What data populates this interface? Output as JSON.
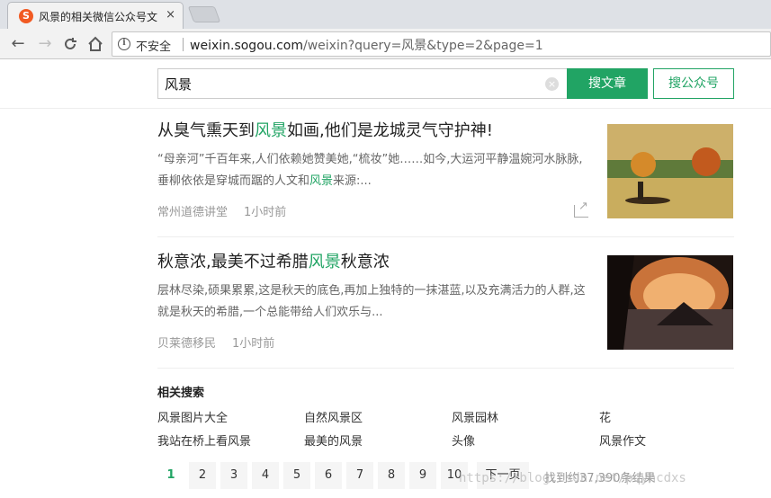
{
  "browser": {
    "tab_title": "风景的相关微信公众号文",
    "tab_close": "×",
    "back": "←",
    "forward": "→",
    "reload": "C",
    "home": "⌂",
    "security_info": "i",
    "insecure_label": "不安全",
    "url_host": "weixin.sogou.com",
    "url_path": "/weixin?query=风景&type=2&page=1"
  },
  "search": {
    "query": "风景",
    "clear": "×",
    "search_articles_label": "搜文章",
    "search_accounts_label": "搜公众号"
  },
  "results": [
    {
      "title_pre": "从臭气熏天到",
      "title_hl": "风景",
      "title_post": "如画,他们是龙城灵气守护神!",
      "desc_pre": "“母亲河”千百年来,人们依赖她赞美她,“梳妆”她……如今,大运河平静温婉河水脉脉,垂柳依依是穿城而踞的人文和",
      "desc_hl": "风景",
      "desc_post": "来源:...",
      "source": "常州道德讲堂",
      "time": "1小时前"
    },
    {
      "title_pre": "秋意浓,最美不过希腊",
      "title_hl": "风景",
      "title_post": "秋意浓",
      "desc_pre": "层林尽染,硕果累累,这是秋天的底色,再加上独特的一抹湛蓝,以及充满活力的人群,这就是秋天的希腊,一个总能带给人们欢乐与...",
      "desc_hl": "",
      "desc_post": "",
      "source": "贝莱德移民",
      "time": "1小时前"
    }
  ],
  "related": {
    "title": "相关搜索",
    "items": [
      "风景图片大全",
      "自然风景区",
      "风景园林",
      "花",
      "我站在桥上看风景",
      "最美的风景",
      "头像",
      "风景作文"
    ]
  },
  "pagination": {
    "pages": [
      "1",
      "2",
      "3",
      "4",
      "5",
      "6",
      "7",
      "8",
      "9",
      "10"
    ],
    "next_label": "下一页",
    "result_count": "找到约37,390条结果"
  },
  "watermark": "https://blog.csdn.net/pqyhcdxs"
}
